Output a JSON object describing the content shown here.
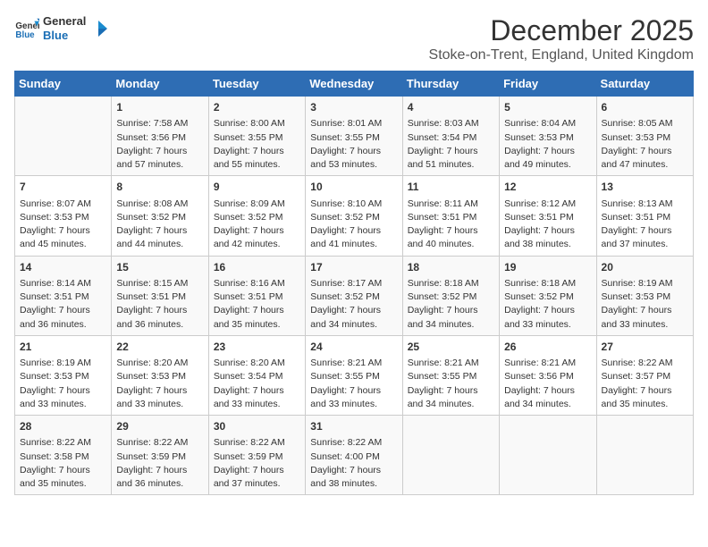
{
  "header": {
    "logo_line1": "General",
    "logo_line2": "Blue",
    "title": "December 2025",
    "subtitle": "Stoke-on-Trent, England, United Kingdom"
  },
  "days_of_week": [
    "Sunday",
    "Monday",
    "Tuesday",
    "Wednesday",
    "Thursday",
    "Friday",
    "Saturday"
  ],
  "weeks": [
    [
      {
        "day": "",
        "content": ""
      },
      {
        "day": "1",
        "content": "Sunrise: 7:58 AM\nSunset: 3:56 PM\nDaylight: 7 hours\nand 57 minutes."
      },
      {
        "day": "2",
        "content": "Sunrise: 8:00 AM\nSunset: 3:55 PM\nDaylight: 7 hours\nand 55 minutes."
      },
      {
        "day": "3",
        "content": "Sunrise: 8:01 AM\nSunset: 3:55 PM\nDaylight: 7 hours\nand 53 minutes."
      },
      {
        "day": "4",
        "content": "Sunrise: 8:03 AM\nSunset: 3:54 PM\nDaylight: 7 hours\nand 51 minutes."
      },
      {
        "day": "5",
        "content": "Sunrise: 8:04 AM\nSunset: 3:53 PM\nDaylight: 7 hours\nand 49 minutes."
      },
      {
        "day": "6",
        "content": "Sunrise: 8:05 AM\nSunset: 3:53 PM\nDaylight: 7 hours\nand 47 minutes."
      }
    ],
    [
      {
        "day": "7",
        "content": "Sunrise: 8:07 AM\nSunset: 3:53 PM\nDaylight: 7 hours\nand 45 minutes."
      },
      {
        "day": "8",
        "content": "Sunrise: 8:08 AM\nSunset: 3:52 PM\nDaylight: 7 hours\nand 44 minutes."
      },
      {
        "day": "9",
        "content": "Sunrise: 8:09 AM\nSunset: 3:52 PM\nDaylight: 7 hours\nand 42 minutes."
      },
      {
        "day": "10",
        "content": "Sunrise: 8:10 AM\nSunset: 3:52 PM\nDaylight: 7 hours\nand 41 minutes."
      },
      {
        "day": "11",
        "content": "Sunrise: 8:11 AM\nSunset: 3:51 PM\nDaylight: 7 hours\nand 40 minutes."
      },
      {
        "day": "12",
        "content": "Sunrise: 8:12 AM\nSunset: 3:51 PM\nDaylight: 7 hours\nand 38 minutes."
      },
      {
        "day": "13",
        "content": "Sunrise: 8:13 AM\nSunset: 3:51 PM\nDaylight: 7 hours\nand 37 minutes."
      }
    ],
    [
      {
        "day": "14",
        "content": "Sunrise: 8:14 AM\nSunset: 3:51 PM\nDaylight: 7 hours\nand 36 minutes."
      },
      {
        "day": "15",
        "content": "Sunrise: 8:15 AM\nSunset: 3:51 PM\nDaylight: 7 hours\nand 36 minutes."
      },
      {
        "day": "16",
        "content": "Sunrise: 8:16 AM\nSunset: 3:51 PM\nDaylight: 7 hours\nand 35 minutes."
      },
      {
        "day": "17",
        "content": "Sunrise: 8:17 AM\nSunset: 3:52 PM\nDaylight: 7 hours\nand 34 minutes."
      },
      {
        "day": "18",
        "content": "Sunrise: 8:18 AM\nSunset: 3:52 PM\nDaylight: 7 hours\nand 34 minutes."
      },
      {
        "day": "19",
        "content": "Sunrise: 8:18 AM\nSunset: 3:52 PM\nDaylight: 7 hours\nand 33 minutes."
      },
      {
        "day": "20",
        "content": "Sunrise: 8:19 AM\nSunset: 3:53 PM\nDaylight: 7 hours\nand 33 minutes."
      }
    ],
    [
      {
        "day": "21",
        "content": "Sunrise: 8:19 AM\nSunset: 3:53 PM\nDaylight: 7 hours\nand 33 minutes."
      },
      {
        "day": "22",
        "content": "Sunrise: 8:20 AM\nSunset: 3:53 PM\nDaylight: 7 hours\nand 33 minutes."
      },
      {
        "day": "23",
        "content": "Sunrise: 8:20 AM\nSunset: 3:54 PM\nDaylight: 7 hours\nand 33 minutes."
      },
      {
        "day": "24",
        "content": "Sunrise: 8:21 AM\nSunset: 3:55 PM\nDaylight: 7 hours\nand 33 minutes."
      },
      {
        "day": "25",
        "content": "Sunrise: 8:21 AM\nSunset: 3:55 PM\nDaylight: 7 hours\nand 34 minutes."
      },
      {
        "day": "26",
        "content": "Sunrise: 8:21 AM\nSunset: 3:56 PM\nDaylight: 7 hours\nand 34 minutes."
      },
      {
        "day": "27",
        "content": "Sunrise: 8:22 AM\nSunset: 3:57 PM\nDaylight: 7 hours\nand 35 minutes."
      }
    ],
    [
      {
        "day": "28",
        "content": "Sunrise: 8:22 AM\nSunset: 3:58 PM\nDaylight: 7 hours\nand 35 minutes."
      },
      {
        "day": "29",
        "content": "Sunrise: 8:22 AM\nSunset: 3:59 PM\nDaylight: 7 hours\nand 36 minutes."
      },
      {
        "day": "30",
        "content": "Sunrise: 8:22 AM\nSunset: 3:59 PM\nDaylight: 7 hours\nand 37 minutes."
      },
      {
        "day": "31",
        "content": "Sunrise: 8:22 AM\nSunset: 4:00 PM\nDaylight: 7 hours\nand 38 minutes."
      },
      {
        "day": "",
        "content": ""
      },
      {
        "day": "",
        "content": ""
      },
      {
        "day": "",
        "content": ""
      }
    ]
  ]
}
